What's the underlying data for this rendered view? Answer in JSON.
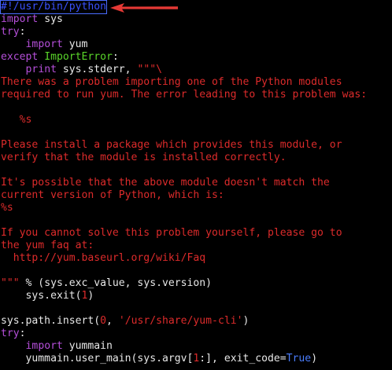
{
  "colors": {
    "background": "#000000",
    "default_text": "#e8e8e8",
    "keyword": "#b54fd9",
    "error_string": "#dd2b2b",
    "builtin_class": "#5ad62a",
    "boolean": "#4a7dff",
    "shebang": "#3a52ff",
    "annotation_arrow": "#e53935"
  },
  "annotation": {
    "icon": "red-arrow-icon"
  },
  "code": {
    "lines": [
      [
        {
          "t": "#!/usr/bin/python",
          "c": "shebang",
          "box": true
        }
      ],
      [
        {
          "t": "import",
          "c": "keyword"
        },
        {
          "t": " sys",
          "c": "default"
        }
      ],
      [
        {
          "t": "try",
          "c": "keyword"
        },
        {
          "t": ":",
          "c": "default"
        }
      ],
      [
        {
          "t": "    ",
          "c": "default"
        },
        {
          "t": "import",
          "c": "keyword"
        },
        {
          "t": " yum",
          "c": "default"
        }
      ],
      [
        {
          "t": "except",
          "c": "keyword"
        },
        {
          "t": " ",
          "c": "default"
        },
        {
          "t": "ImportError",
          "c": "builtin"
        },
        {
          "t": ":",
          "c": "default"
        }
      ],
      [
        {
          "t": "    ",
          "c": "default"
        },
        {
          "t": "print",
          "c": "keyword"
        },
        {
          "t": " sys.stderr, ",
          "c": "default"
        },
        {
          "t": "\"\"\"\\",
          "c": "error"
        }
      ],
      [
        {
          "t": "There was a problem importing one of the Python modules",
          "c": "error"
        }
      ],
      [
        {
          "t": "required to run yum. The error leading to this problem was:",
          "c": "error"
        }
      ],
      [
        {
          "t": "",
          "c": "default"
        }
      ],
      [
        {
          "t": "   %s",
          "c": "error"
        }
      ],
      [
        {
          "t": "",
          "c": "default"
        }
      ],
      [
        {
          "t": "Please install a package which provides this module, or",
          "c": "error"
        }
      ],
      [
        {
          "t": "verify that the module is installed correctly.",
          "c": "error"
        }
      ],
      [
        {
          "t": "",
          "c": "default"
        }
      ],
      [
        {
          "t": "It's possible that the above module doesn't match the",
          "c": "error"
        }
      ],
      [
        {
          "t": "current version of Python, which is:",
          "c": "error"
        }
      ],
      [
        {
          "t": "%s",
          "c": "error"
        }
      ],
      [
        {
          "t": "",
          "c": "default"
        }
      ],
      [
        {
          "t": "If you cannot solve this problem yourself, please go to",
          "c": "error"
        }
      ],
      [
        {
          "t": "the yum faq at:",
          "c": "error"
        }
      ],
      [
        {
          "t": "  http://yum.baseurl.org/wiki/Faq",
          "c": "error"
        }
      ],
      [
        {
          "t": "",
          "c": "default"
        }
      ],
      [
        {
          "t": "\"\"\"",
          "c": "error"
        },
        {
          "t": " % (sys.exc_value, sys.version)",
          "c": "default"
        }
      ],
      [
        {
          "t": "    sys.exit(",
          "c": "default"
        },
        {
          "t": "1",
          "c": "number"
        },
        {
          "t": ")",
          "c": "default"
        }
      ],
      [
        {
          "t": "",
          "c": "default"
        }
      ],
      [
        {
          "t": "sys.path.insert(",
          "c": "default"
        },
        {
          "t": "0",
          "c": "number"
        },
        {
          "t": ", ",
          "c": "default"
        },
        {
          "t": "'/usr/share/yum-cli'",
          "c": "error"
        },
        {
          "t": ")",
          "c": "default"
        }
      ],
      [
        {
          "t": "try",
          "c": "keyword"
        },
        {
          "t": ":",
          "c": "default"
        }
      ],
      [
        {
          "t": "    ",
          "c": "default"
        },
        {
          "t": "import",
          "c": "keyword"
        },
        {
          "t": " yummain",
          "c": "default"
        }
      ],
      [
        {
          "t": "    yummain.user_main(sys.argv[",
          "c": "default"
        },
        {
          "t": "1",
          "c": "number"
        },
        {
          "t": ":], exit_code=",
          "c": "default"
        },
        {
          "t": "True",
          "c": "true"
        },
        {
          "t": ")",
          "c": "default"
        }
      ]
    ]
  }
}
